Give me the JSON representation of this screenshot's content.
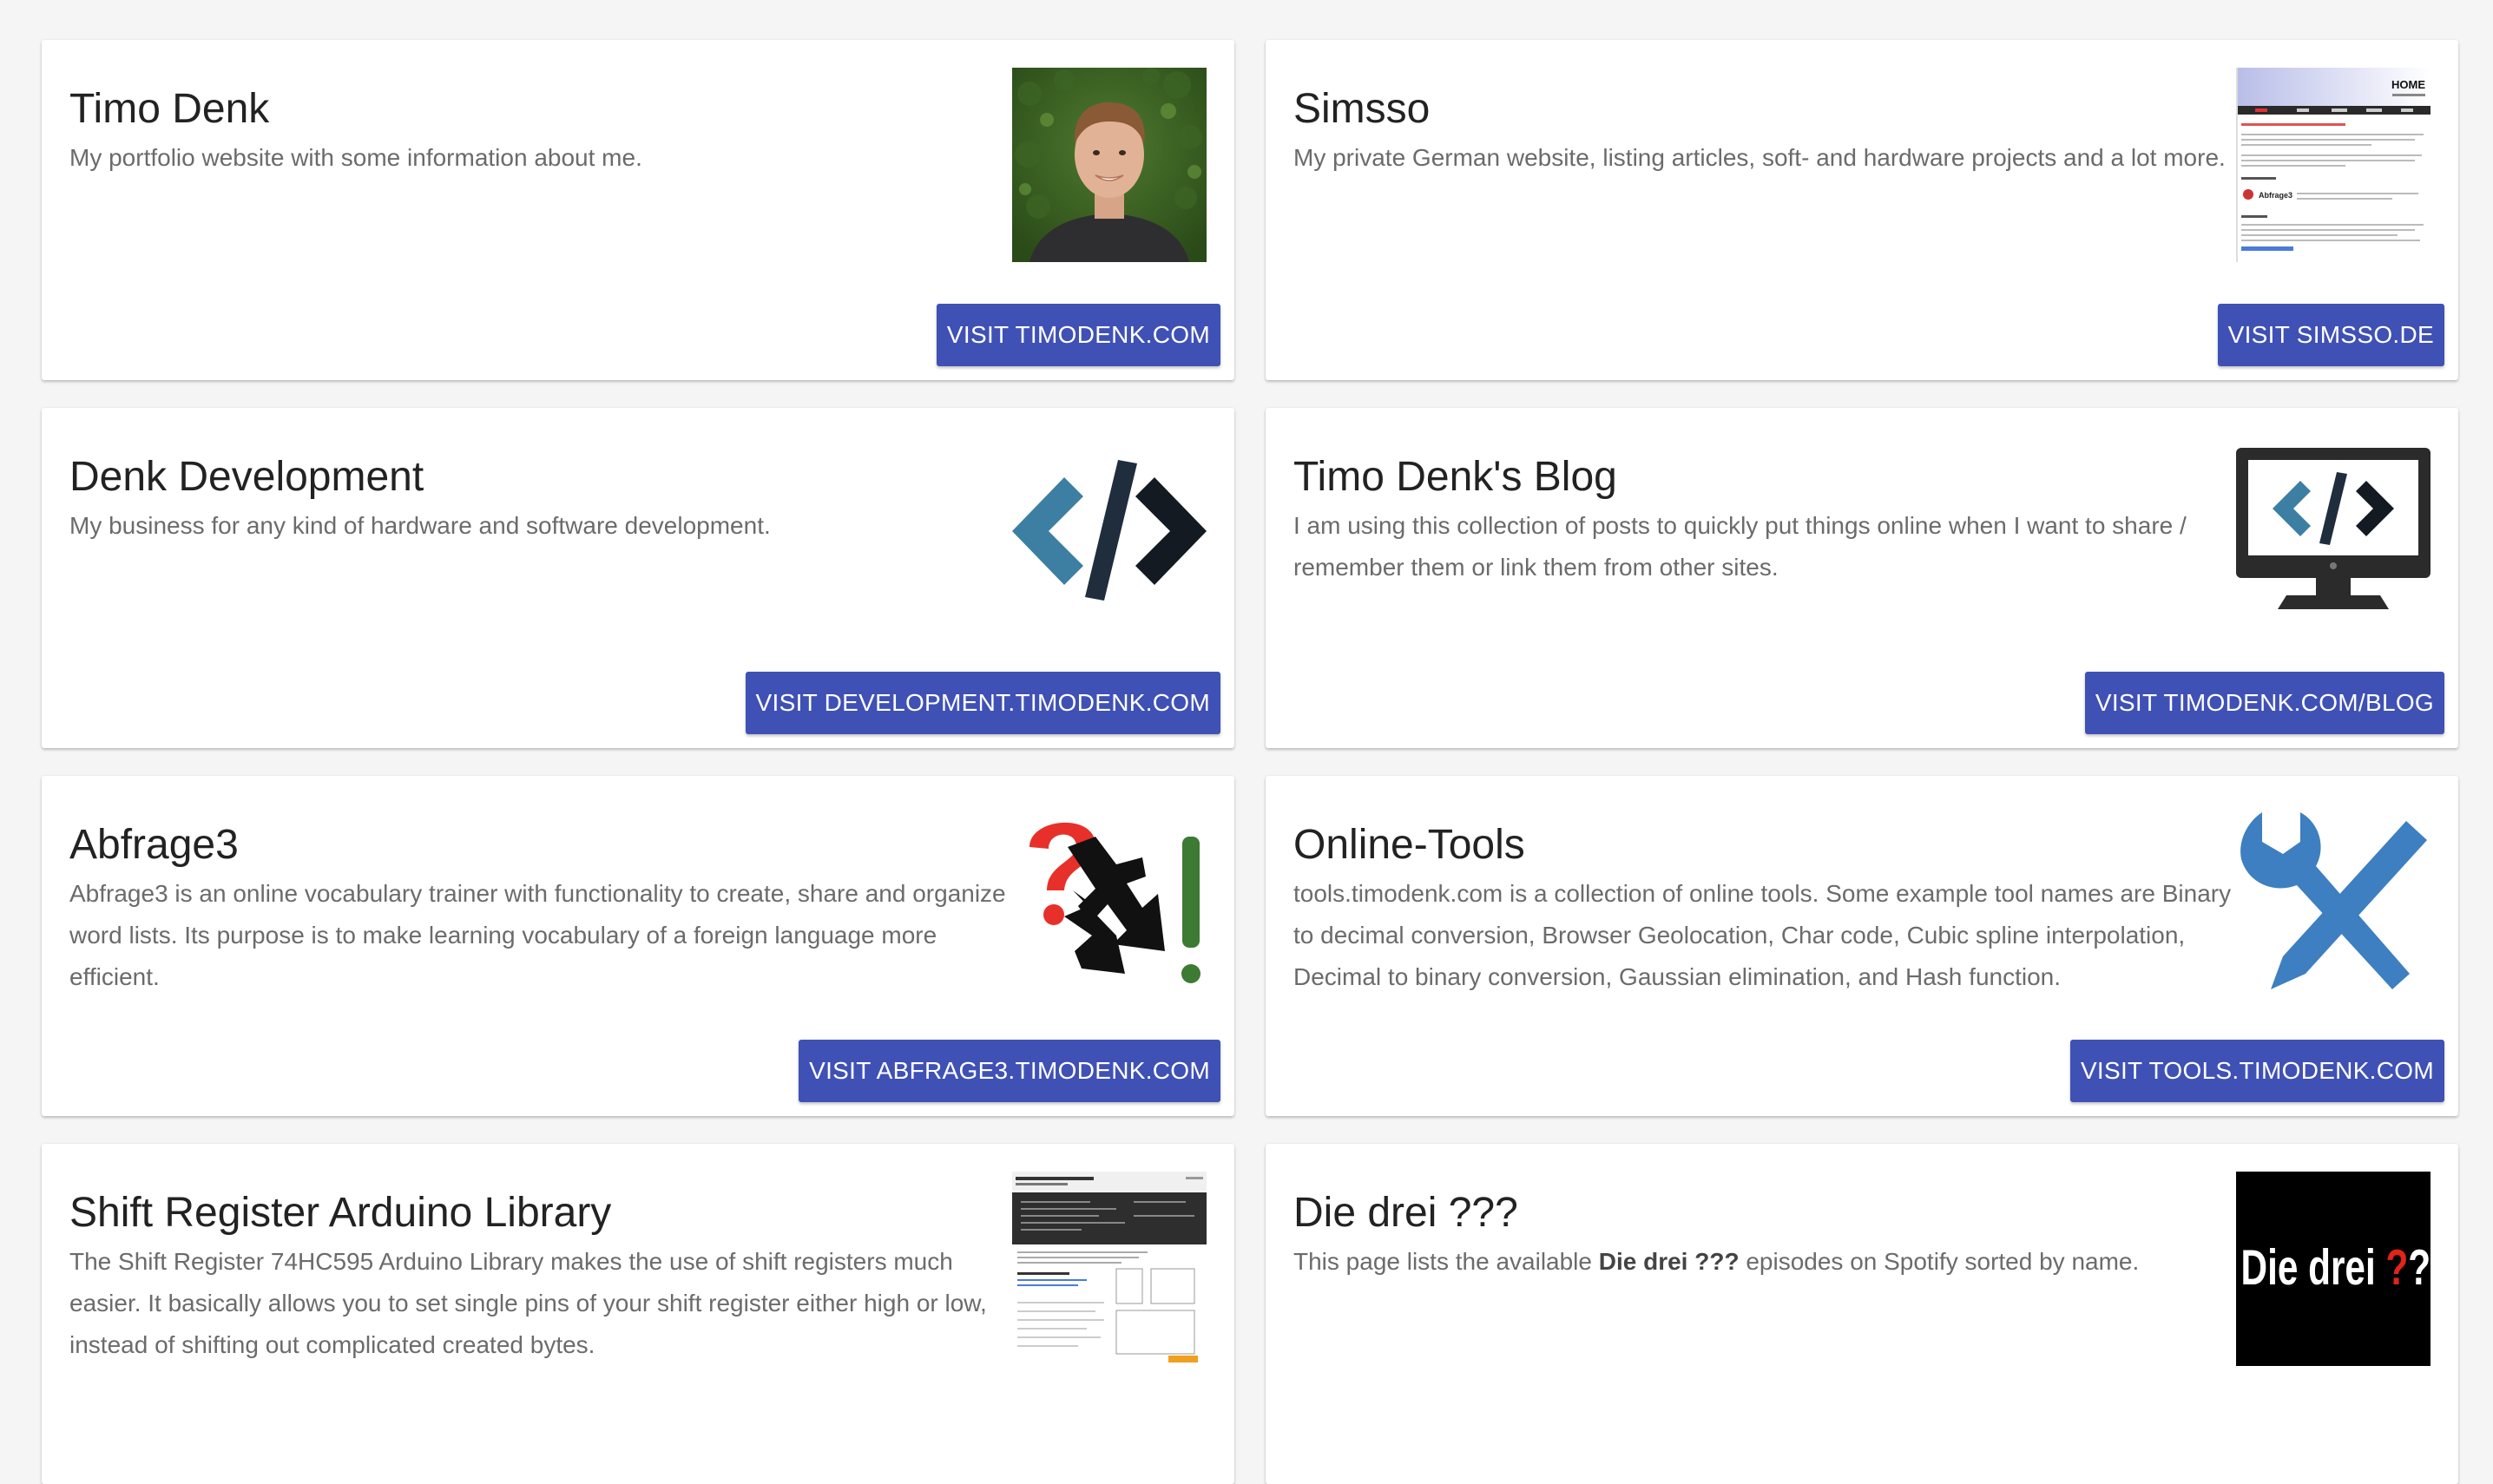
{
  "cards": [
    {
      "title": "Timo Denk",
      "description": "My portfolio website with some information about me.",
      "button": "VISIT TIMODENK.COM",
      "thumbnail": "portrait-photo"
    },
    {
      "title": "Simsso",
      "description": "My private German website, listing articles, soft- and hardware projects and a lot more.",
      "button": "VISIT SIMSSO.DE",
      "thumbnail": "website-screenshot",
      "thumb_text": {
        "home": "HOME",
        "abfrage3": "Abfrage3"
      }
    },
    {
      "title": "Denk Development",
      "description": "My business for any kind of hardware and software development.",
      "button": "VISIT DEVELOPMENT.TIMODENK.COM",
      "thumbnail": "code-brackets-icon"
    },
    {
      "title": "Timo Denk's Blog",
      "description": "I am using this collection of posts to quickly put things online when I want to share / remember them or link them from other sites.",
      "button": "VISIT TIMODENK.COM/BLOG",
      "thumbnail": "monitor-code-icon"
    },
    {
      "title": "Abfrage3",
      "description": "Abfrage3 is an online vocabulary trainer with functionality to create, share and organize word lists. Its purpose is to make learning vocabulary of a foreign language more efficient.",
      "button": "VISIT ABFRAGE3.TIMODENK.COM",
      "thumbnail": "question-arrow-exclamation-logo"
    },
    {
      "title": "Online-Tools",
      "description": "tools.timodenk.com is a collection of online tools. Some example tool names are Binary to decimal conversion, Browser Geolocation, Char code, Cubic spline interpolation, Decimal to binary conversion, Gaussian elimination, and Hash function.",
      "button": "VISIT TOOLS.TIMODENK.COM",
      "thumbnail": "wrench-screwdriver-icon"
    },
    {
      "title": "Shift Register Arduino Library",
      "description": "The Shift Register 74HC595 Arduino Library makes the use of shift registers much easier. It basically allows you to set single pins of your shift register either high or low, instead of shifting out complicated created bytes.",
      "thumbnail": "library-page-screenshot"
    },
    {
      "title": "Die drei ???",
      "description_parts": {
        "before": "This page lists the available ",
        "bold": "Die drei ???",
        "after": " episodes on Spotify sorted by name."
      },
      "thumbnail": "die-drei-logo",
      "logo_text": {
        "white": "Die drei ",
        "red": "?",
        "white2": "?",
        "blue": "?"
      }
    }
  ],
  "colors": {
    "button": "#3f51b5",
    "title": "#222222",
    "description": "#6b6b6b",
    "background": "#f5f5f5"
  }
}
